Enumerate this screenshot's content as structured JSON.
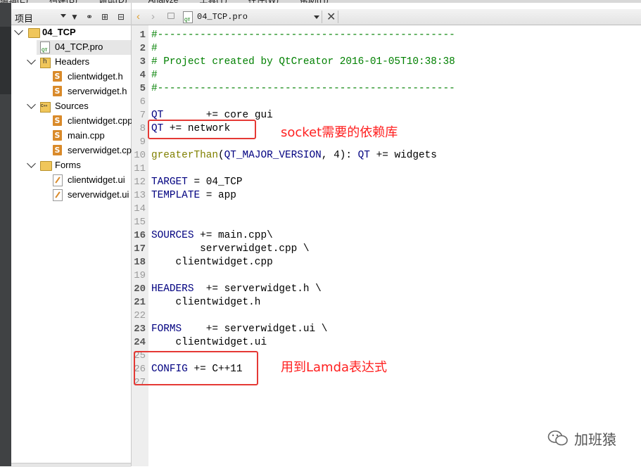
{
  "menubar_clipped": [
    "编辑(E)",
    "构建(B)",
    "调试(D)",
    "Analyze",
    "工具(T)",
    "控件(W)",
    "帮助(H)"
  ],
  "project_panel": {
    "title": "项目",
    "tree": [
      {
        "label": "04_TCP",
        "kind": "project-root",
        "expanded": true
      },
      {
        "label": "04_TCP.pro",
        "kind": "pro-file",
        "selected": true
      },
      {
        "label": "Headers",
        "kind": "folder",
        "expanded": true
      },
      {
        "label": "clientwidget.h",
        "kind": "source"
      },
      {
        "label": "serverwidget.h",
        "kind": "source"
      },
      {
        "label": "Sources",
        "kind": "folder",
        "expanded": true
      },
      {
        "label": "clientwidget.cpp",
        "kind": "source"
      },
      {
        "label": "main.cpp",
        "kind": "source"
      },
      {
        "label": "serverwidget.cpp",
        "kind": "source"
      },
      {
        "label": "Forms",
        "kind": "folder",
        "expanded": true
      },
      {
        "label": "clientwidget.ui",
        "kind": "ui"
      },
      {
        "label": "serverwidget.ui",
        "kind": "ui"
      }
    ]
  },
  "editor": {
    "filename": "04_TCP.pro",
    "lines": [
      "#-------------------------------------------------",
      "#",
      "# Project created by QtCreator 2016-01-05T10:38:38",
      "#",
      "#-------------------------------------------------",
      "",
      "QT       += core gui",
      "QT += network",
      "",
      "greaterThan(QT_MAJOR_VERSION, 4): QT += widgets",
      "",
      "TARGET = 04_TCP",
      "TEMPLATE = app",
      "",
      "",
      "SOURCES += main.cpp\\",
      "        serverwidget.cpp \\",
      "    clientwidget.cpp",
      "",
      "HEADERS  += serverwidget.h \\",
      "    clientwidget.h",
      "",
      "FORMS    += serverwidget.ui \\",
      "    clientwidget.ui",
      "",
      "CONFIG += C++11",
      ""
    ]
  },
  "annotations": {
    "network_note": "socket需要的依赖库",
    "config_note": "用到Lamda表达式"
  },
  "watermark": "加班猿",
  "colors": {
    "annotation": "#ff2020",
    "comment": "#008000",
    "keyword": "#000080",
    "function": "#808000"
  }
}
